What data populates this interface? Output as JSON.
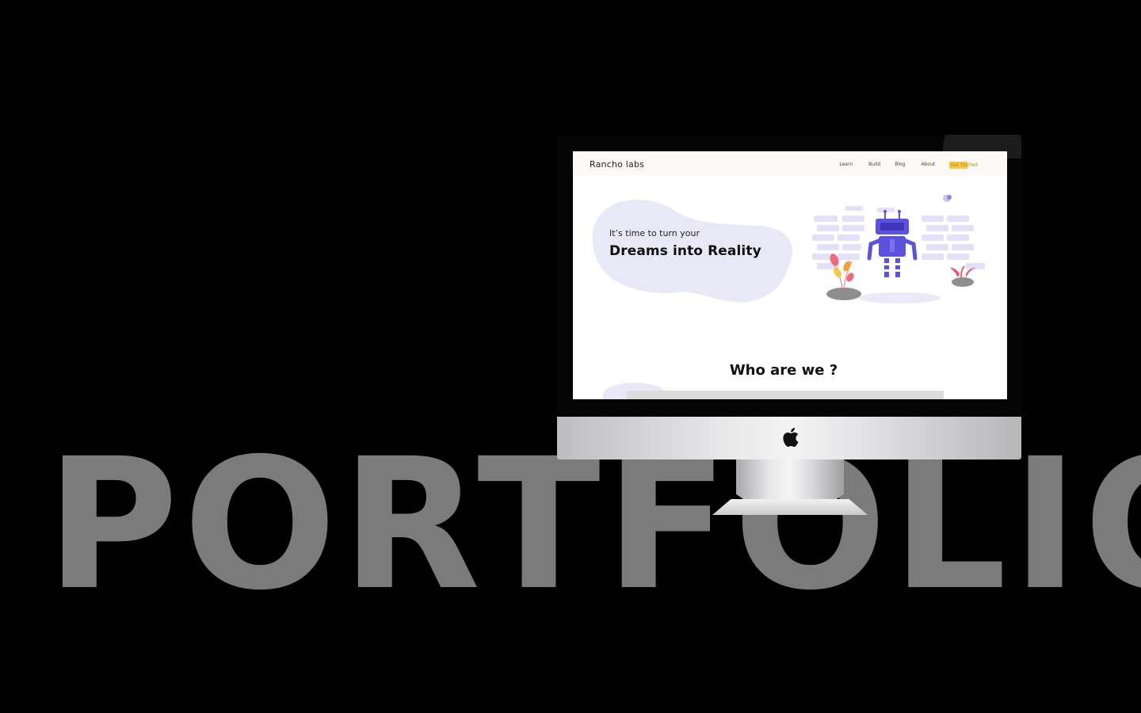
{
  "background_word": "PORTFOLIO",
  "colors": {
    "background": "#000000",
    "background_word": "#7b7b7b",
    "site_accent": "#5b53e0",
    "cta_highlight": "#f7c948",
    "blob": "#e9e8f6"
  },
  "device": {
    "type": "iMac",
    "logo": "apple-icon"
  },
  "site": {
    "brand": "Rancho labs",
    "nav": {
      "learn": "Learn",
      "build": "Build",
      "blog": "Blog",
      "about": "About",
      "cta": "Get Started"
    },
    "hero": {
      "subtitle": "It’s time to turn your",
      "title": "Dreams into Reality",
      "illustration": "robot-illustration"
    },
    "section_title": "Who are we ?"
  }
}
